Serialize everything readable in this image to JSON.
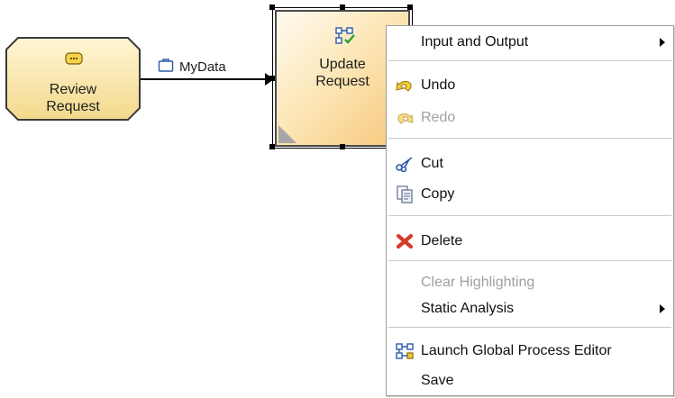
{
  "diagram": {
    "review_node": {
      "label_line1": "Review",
      "label_line2": "Request",
      "icon": "task-icon"
    },
    "update_node": {
      "label_line1": "Update",
      "label_line2": "Request",
      "icon": "process-icon"
    },
    "connection": {
      "data_label": "MyData",
      "icon": "bag-icon"
    }
  },
  "context_menu": {
    "items": [
      {
        "label": "Input and Output",
        "enabled": true,
        "submenu": true,
        "icon": ""
      },
      {
        "label": "Undo",
        "enabled": true,
        "submenu": false,
        "icon": "undo-icon"
      },
      {
        "label": "Redo",
        "enabled": false,
        "submenu": false,
        "icon": "redo-icon"
      },
      {
        "label": "Cut",
        "enabled": true,
        "submenu": false,
        "icon": "scissors-icon"
      },
      {
        "label": "Copy",
        "enabled": true,
        "submenu": false,
        "icon": "copy-icon"
      },
      {
        "label": "Delete",
        "enabled": true,
        "submenu": false,
        "icon": "delete-icon"
      },
      {
        "label": "Clear Highlighting",
        "enabled": false,
        "submenu": false,
        "icon": ""
      },
      {
        "label": "Static Analysis",
        "enabled": true,
        "submenu": true,
        "icon": ""
      },
      {
        "label": "Launch Global Process Editor",
        "enabled": true,
        "submenu": false,
        "icon": "process-icon"
      },
      {
        "label": "Save",
        "enabled": true,
        "submenu": false,
        "icon": ""
      }
    ]
  },
  "colors": {
    "node_fill": "#fbe6a5",
    "node_border": "#4a4a4a",
    "disabled_text": "#a0a0a0"
  }
}
